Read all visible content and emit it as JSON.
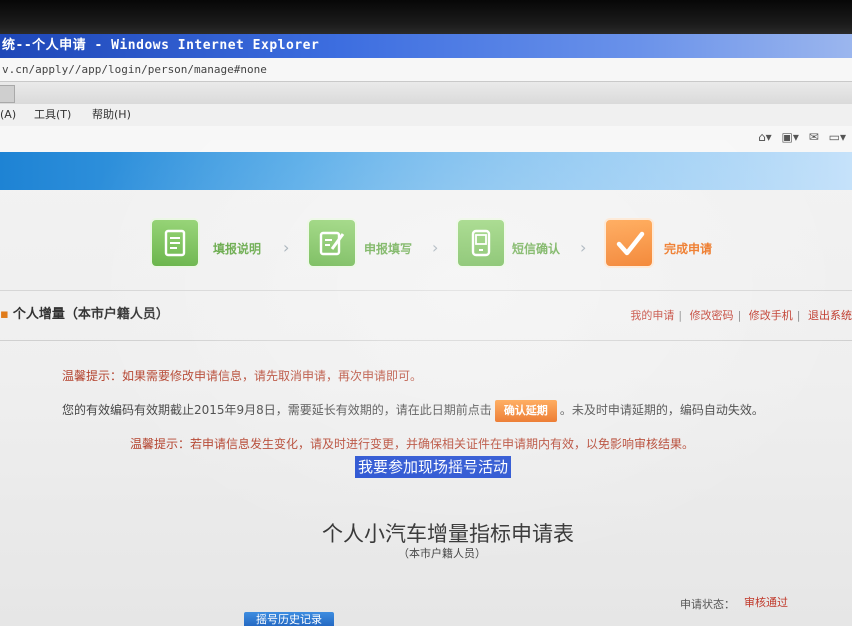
{
  "window": {
    "title": "统--个人申请 - Windows Internet Explorer",
    "address": "v.cn/apply//app/login/person/manage#none"
  },
  "menu": {
    "items": [
      "(A)",
      "工具(T)",
      "帮助(H)"
    ]
  },
  "toolbar": {
    "icons": [
      "home-icon",
      "rss-feed-icon",
      "mail-icon",
      "printer-icon"
    ]
  },
  "steps": [
    {
      "label": "填报说明",
      "state": "done",
      "color": "#5fb03e"
    },
    {
      "label": "申报填写",
      "state": "done",
      "color": "#5fb03e"
    },
    {
      "label": "短信确认",
      "state": "done",
      "color": "#5fb03e"
    },
    {
      "label": "完成申请",
      "state": "current",
      "color": "#f16f0f"
    }
  ],
  "section": {
    "title": "个人增量（本市户籍人员）",
    "links": [
      "我的申请",
      "修改密码",
      "修改手机",
      "退出系统"
    ]
  },
  "notices": {
    "notice1": "温馨提示：如果需要修改申请信息，请先取消申请，再次申请即可。",
    "valid_prefix": "您的有效编码有效期截止2015年9月8日，需要延长有效期的，请在此日期前点击",
    "extend_button": "确认延期",
    "valid_suffix": "。未及时申请延期的，编码自动失效。",
    "notice2": "温馨提示：若申请信息发生变化，请及时进行变更，并确保相关证件在申请期内有效，以免影响审核结果。",
    "highlighted": "我要参加现场摇号活动"
  },
  "form": {
    "title": "个人小汽车增量指标申请表",
    "subtitle": "（本市户籍人员）",
    "status_label": "申请状态：",
    "status_value": "审核通过",
    "bottom_button": "摇号历史记录"
  },
  "colors": {
    "accent_orange": "#f16f0f",
    "step_green": "#5fb03e",
    "notice_red": "#b3412c",
    "link_red": "#c0392b",
    "selection_blue": "#1c48cf"
  }
}
